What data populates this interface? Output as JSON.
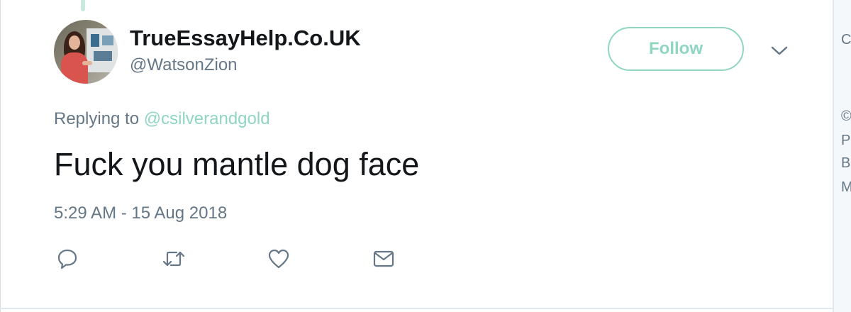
{
  "tweet": {
    "display_name": "TrueEssayHelp.Co.UK",
    "handle": "@WatsonZion",
    "follow_label": "Follow",
    "replying_prefix": "Replying to",
    "replying_to": "@csilverandgold",
    "text": "Fuck you mantle dog face",
    "timestamp": "5:29 AM - 15 Aug 2018"
  },
  "actions": [
    {
      "name": "reply",
      "icon": "speech-bubble-icon"
    },
    {
      "name": "retweet",
      "icon": "retweet-arrows-icon"
    },
    {
      "name": "like",
      "icon": "heart-outline-icon"
    },
    {
      "name": "direct-message",
      "icon": "envelope-icon"
    }
  ],
  "side_panel_fragments": [
    "C",
    "©",
    "P",
    "B",
    "M"
  ],
  "colors": {
    "accent": "#8fd6c0",
    "text_primary": "#14171a",
    "text_secondary": "#657786",
    "border": "#e1e8ed"
  }
}
